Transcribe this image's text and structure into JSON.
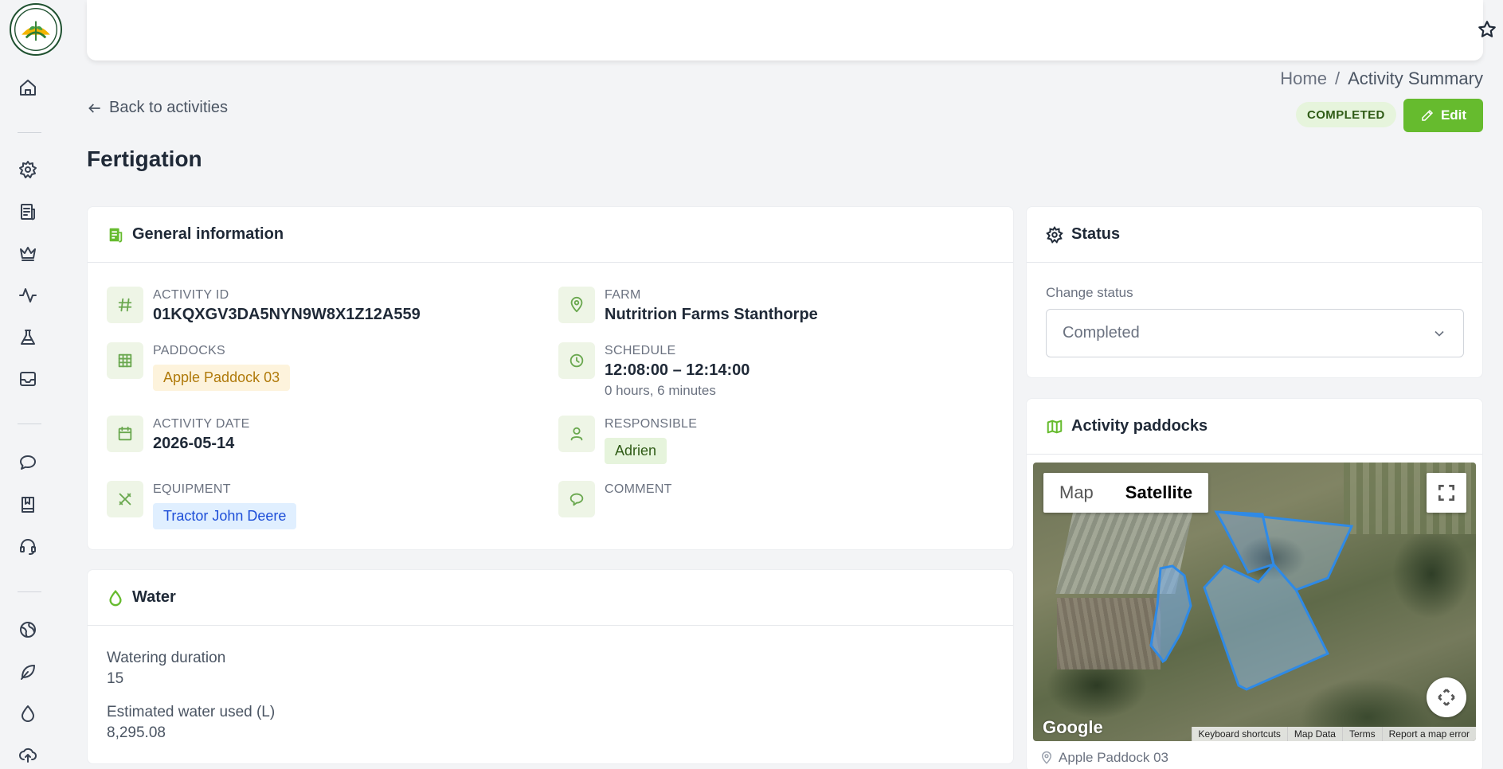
{
  "colors": {
    "accent": "#66bb2e",
    "badge_bg": "#e6f4dc",
    "badge_text": "#2f5b16"
  },
  "sidebar": {
    "icons": [
      "home-icon",
      "settings-icon",
      "report-icon",
      "crown-icon",
      "activity-icon",
      "flask-icon",
      "inbox-icon",
      "chat-icon",
      "book-icon",
      "headset-icon",
      "globe-icon",
      "leaf-icon",
      "droplet-icon",
      "cloud-upload-icon"
    ]
  },
  "header": {
    "icons": [
      "star-icon",
      "avatar"
    ]
  },
  "breadcrumb": {
    "home": "Home",
    "separator": "/",
    "current": "Activity Summary"
  },
  "back_link": "Back to activities",
  "status_badge": "COMPLETED",
  "edit_button": "Edit",
  "page_title": "Fertigation",
  "general": {
    "title": "General information",
    "activity_id_label": "ACTIVITY ID",
    "activity_id": "01KQXGV3DA5NYN9W8X1Z12A559",
    "farm_label": "FARM",
    "farm": "Nutritrion Farms Stanthorpe",
    "paddocks_label": "PADDOCKS",
    "paddock": "Apple Paddock 03",
    "schedule_label": "SCHEDULE",
    "schedule": "12:08:00 – 12:14:00",
    "schedule_duration": "0 hours, 6 minutes",
    "activity_date_label": "ACTIVITY DATE",
    "activity_date": "2026-05-14",
    "responsible_label": "RESPONSIBLE",
    "responsible": "Adrien",
    "equipment_label": "EQUIPMENT",
    "equipment": "Tractor John Deere",
    "comment_label": "COMMENT"
  },
  "water": {
    "title": "Water",
    "watering_duration_label": "Watering duration",
    "watering_duration": "15",
    "estimated_water_label": "Estimated water used (L)",
    "estimated_water": "8,295.08"
  },
  "status_card": {
    "title": "Status",
    "change_status_label": "Change status",
    "selected": "Completed"
  },
  "paddocks_card": {
    "title": "Activity paddocks",
    "map_tab": "Map",
    "satellite_tab": "Satellite",
    "google": "Google",
    "footer": [
      "Keyboard shortcuts",
      "Map Data",
      "Terms",
      "Report a map error"
    ],
    "caption": "Apple Paddock 03"
  }
}
